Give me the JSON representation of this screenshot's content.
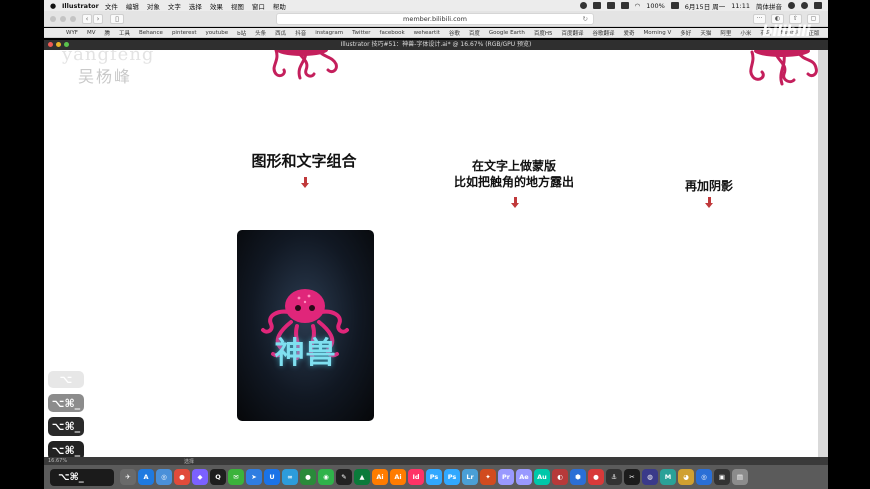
{
  "menubar": {
    "app_name": "Illustrator",
    "items": [
      "文件",
      "编辑",
      "对象",
      "文字",
      "选择",
      "效果",
      "视图",
      "窗口",
      "帮助"
    ],
    "battery": "100%",
    "date": "6月15日 周一",
    "time": "11:11",
    "input_method": "简体拼音"
  },
  "browser": {
    "url": "member.bilibili.com",
    "back_glyph": "‹",
    "forward_glyph": "›",
    "reload_glyph": "↻"
  },
  "bookmarks": [
    "WYF",
    "MV",
    "腾",
    "工具",
    "Behance",
    "pinterest",
    "youtube",
    "b站",
    "头条",
    "西瓜",
    "抖音",
    "instagram",
    "Twitter",
    "facebook",
    "weheartit",
    "谷歌",
    "百度",
    "Google Earth",
    "百度H5",
    "百度翻译",
    "谷歌翻译",
    "爱奇",
    "Morning V",
    "多好",
    "天猫",
    "阿里",
    "小米",
    "有品",
    "freepik",
    "正版",
    "dribbb"
  ],
  "ai_window": {
    "title": "Illustrator 技巧#51：神兽-字体设计.ai* @ 16.67% (RGB/GPU 预览)"
  },
  "canvas": {
    "watermark_en": "yangfeng",
    "watermark_cn": "吴杨峰",
    "heading_1": "图形和文字组合",
    "heading_2_line1": "在文字上做蒙版",
    "heading_2_line2": "比如把触角的地方露出",
    "heading_3": "再加阴影",
    "poster_text": "神兽"
  },
  "hud_keys": [
    "⌥",
    "⌥⌘_",
    "⌥⌘_",
    "⌥⌘_"
  ],
  "status": {
    "zoom": "16.67%",
    "tool": "选择"
  },
  "dock": {
    "key_overlay": "⌥⌘_",
    "apps": [
      {
        "label": "✈",
        "color": "#6a6a6a"
      },
      {
        "label": "A",
        "color": "#1f7ae0"
      },
      {
        "label": "◎",
        "color": "#4a90d9"
      },
      {
        "label": "●",
        "color": "#e14b3b"
      },
      {
        "label": "◆",
        "color": "#7b61ff"
      },
      {
        "label": "Q",
        "color": "#1e1e1e"
      },
      {
        "label": "✉",
        "color": "#3bb33b"
      },
      {
        "label": "➤",
        "color": "#2f7de1"
      },
      {
        "label": "U",
        "color": "#1a73e8"
      },
      {
        "label": "∞",
        "color": "#2d9cdb"
      },
      {
        "label": "●",
        "color": "#2a8a3a"
      },
      {
        "label": "◉",
        "color": "#2fb34a"
      },
      {
        "label": "✎",
        "color": "#222222"
      },
      {
        "label": "▲",
        "color": "#0a7a3a"
      },
      {
        "label": "Ai",
        "color": "#ff7c00"
      },
      {
        "label": "Ai",
        "color": "#ff7c00"
      },
      {
        "label": "Id",
        "color": "#ff3366"
      },
      {
        "label": "Ps",
        "color": "#31a8ff"
      },
      {
        "label": "Ps",
        "color": "#31a8ff"
      },
      {
        "label": "Lr",
        "color": "#4a9fd6"
      },
      {
        "label": "✦",
        "color": "#d14b1f"
      },
      {
        "label": "Pr",
        "color": "#9999ff"
      },
      {
        "label": "Ae",
        "color": "#9999ff"
      },
      {
        "label": "Au",
        "color": "#00c7a9"
      },
      {
        "label": "◐",
        "color": "#b73a3a"
      },
      {
        "label": "⬢",
        "color": "#2b6fd6"
      },
      {
        "label": "●",
        "color": "#d83a3a"
      },
      {
        "label": "⚓",
        "color": "#333333"
      },
      {
        "label": "✂",
        "color": "#1c1c1c"
      },
      {
        "label": "◍",
        "color": "#3a3a8a"
      },
      {
        "label": "M",
        "color": "#2aa198"
      },
      {
        "label": "◕",
        "color": "#d0a030"
      },
      {
        "label": "◎",
        "color": "#2a6fd6"
      },
      {
        "label": "▣",
        "color": "#333333"
      },
      {
        "label": "▤",
        "color": "#8c8c8c"
      }
    ]
  },
  "colors": {
    "accent_red": "#c0393b",
    "octopus_pink": "#e0267a",
    "poster_text": "#7fe0f0"
  }
}
